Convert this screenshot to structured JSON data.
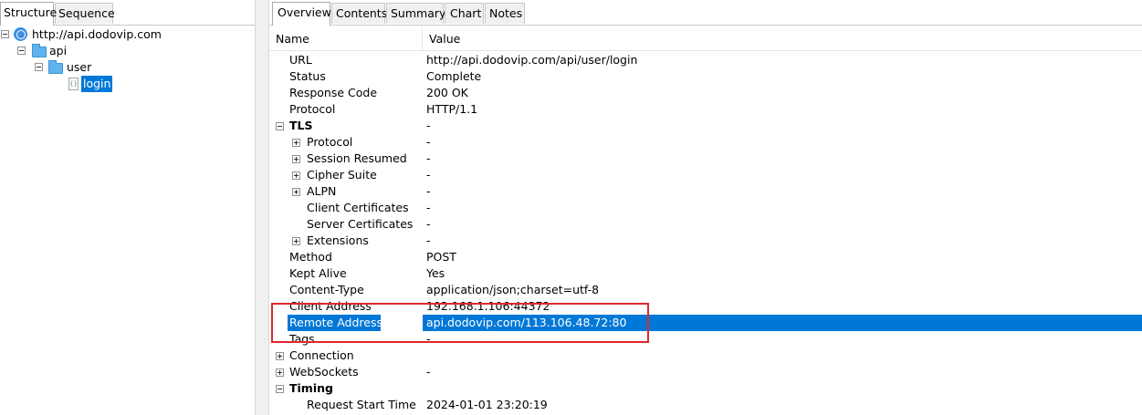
{
  "left_tabs": [
    "Structure",
    "Sequence"
  ],
  "right_tabs": [
    "Overview",
    "Contents",
    "Summary",
    "Chart",
    "Notes"
  ],
  "tree": {
    "host": "http://api.dodovip.com",
    "folder1": "api",
    "folder2": "user",
    "leaf": "login",
    "leaf_icon_text": "{}"
  },
  "table": {
    "col_name": "Name",
    "col_value": "Value",
    "rows": [
      {
        "name": "URL",
        "value": "http://api.dodovip.com/api/user/login"
      },
      {
        "name": "Status",
        "value": "Complete"
      },
      {
        "name": "Response Code",
        "value": "200 OK"
      },
      {
        "name": "Protocol",
        "value": "HTTP/1.1"
      },
      {
        "name": "TLS",
        "value": "-"
      },
      {
        "name": "Protocol",
        "value": "-"
      },
      {
        "name": "Session Resumed",
        "value": "-"
      },
      {
        "name": "Cipher Suite",
        "value": "-"
      },
      {
        "name": "ALPN",
        "value": "-"
      },
      {
        "name": "Client Certificates",
        "value": "-"
      },
      {
        "name": "Server Certificates",
        "value": "-"
      },
      {
        "name": "Extensions",
        "value": "-"
      },
      {
        "name": "Method",
        "value": "POST"
      },
      {
        "name": "Kept Alive",
        "value": "Yes"
      },
      {
        "name": "Content-Type",
        "value": "application/json;charset=utf-8"
      },
      {
        "name": "Client Address",
        "value": "192.168.1.106:44372"
      },
      {
        "name": "Remote Address",
        "value": "api.dodovip.com/113.106.48.72:80"
      },
      {
        "name": "Tags",
        "value": "-"
      },
      {
        "name": "Connection",
        "value": ""
      },
      {
        "name": "WebSockets",
        "value": "-"
      },
      {
        "name": "Timing",
        "value": ""
      },
      {
        "name": "Request Start Time",
        "value": "2024-01-01 23:20:19"
      }
    ]
  },
  "colors": {
    "selection": "#0078d7",
    "annotation_box": "#e0282e"
  }
}
